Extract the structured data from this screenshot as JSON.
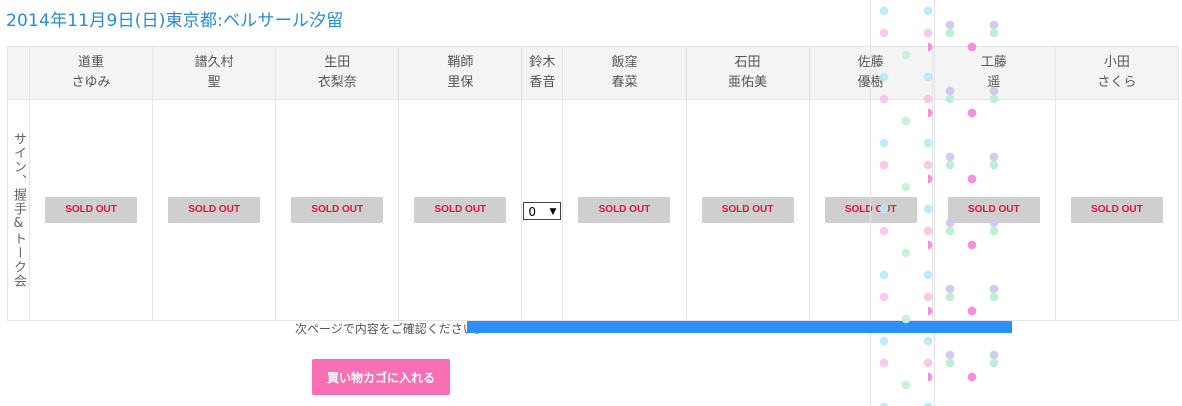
{
  "event": {
    "title": "2014年11月9日(日)東京都:ベルサール汐留"
  },
  "table": {
    "row_label": "サイン、握手&トーク会",
    "columns": [
      {
        "surname": "道重",
        "given": "さゆみ",
        "status": "SOLD OUT"
      },
      {
        "surname": "譜久村",
        "given": "聖",
        "status": "SOLD OUT"
      },
      {
        "surname": "生田",
        "given": "衣梨奈",
        "status": "SOLD OUT"
      },
      {
        "surname": "鞘師",
        "given": "里保",
        "status": "SOLD OUT"
      },
      {
        "surname": "鈴木",
        "given": "香音",
        "quantity": "0"
      },
      {
        "surname": "飯窪",
        "given": "春菜",
        "status": "SOLD OUT"
      },
      {
        "surname": "石田",
        "given": "亜佑美",
        "status": "SOLD OUT"
      },
      {
        "surname": "佐藤",
        "given": "優樹",
        "status": "SOLD OUT"
      },
      {
        "surname": "工藤",
        "given": "遥",
        "status": "SOLD OUT"
      },
      {
        "surname": "小田",
        "given": "さくら",
        "status": "SOLD OUT"
      }
    ]
  },
  "notice": "次ページで内容をご確認ください。",
  "cart_button": "買い物カゴに入れる",
  "colors": {
    "title": "#2a8bd6",
    "sold_out_text": "#e2123a",
    "cart_button_bg": "#f86fb5",
    "notice_bar": "#2f8ef5"
  }
}
